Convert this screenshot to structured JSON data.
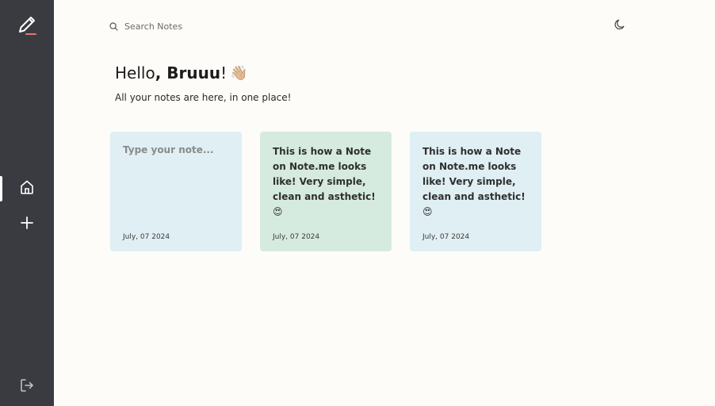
{
  "sidebar": {
    "logo_icon": "pencil-logo-icon",
    "items": [
      {
        "icon": "home-icon",
        "label": "Home"
      },
      {
        "icon": "plus-icon",
        "label": "Add note"
      }
    ],
    "logout_icon": "logout-icon"
  },
  "search": {
    "placeholder": "Search Notes",
    "icon": "search-icon"
  },
  "theme_toggle": {
    "icon": "moon-icon"
  },
  "greeting": {
    "prefix": "Hello",
    "name": ", Bruuu",
    "suffix": "!",
    "emoji": "👋🏼"
  },
  "subtitle": "All your notes are here, in one place!",
  "notes": [
    {
      "placeholder": "Type your note...",
      "text": "",
      "date": "July, 07 2024",
      "color": "#dfeff3"
    },
    {
      "text": "This is how a Note on Note.me looks like! Very simple, clean and asthetic! 😍",
      "date": "July, 07 2024",
      "color": "#d6ebe0"
    },
    {
      "text": "This is how a Note on Note.me looks like! Very simple, clean and asthetic! 😍",
      "date": "July, 07 2024",
      "color": "#dfeff3"
    }
  ],
  "colors": {
    "sidebar": "#3a3b40",
    "background": "#fdfcf9",
    "accent": "#e07a6a"
  }
}
